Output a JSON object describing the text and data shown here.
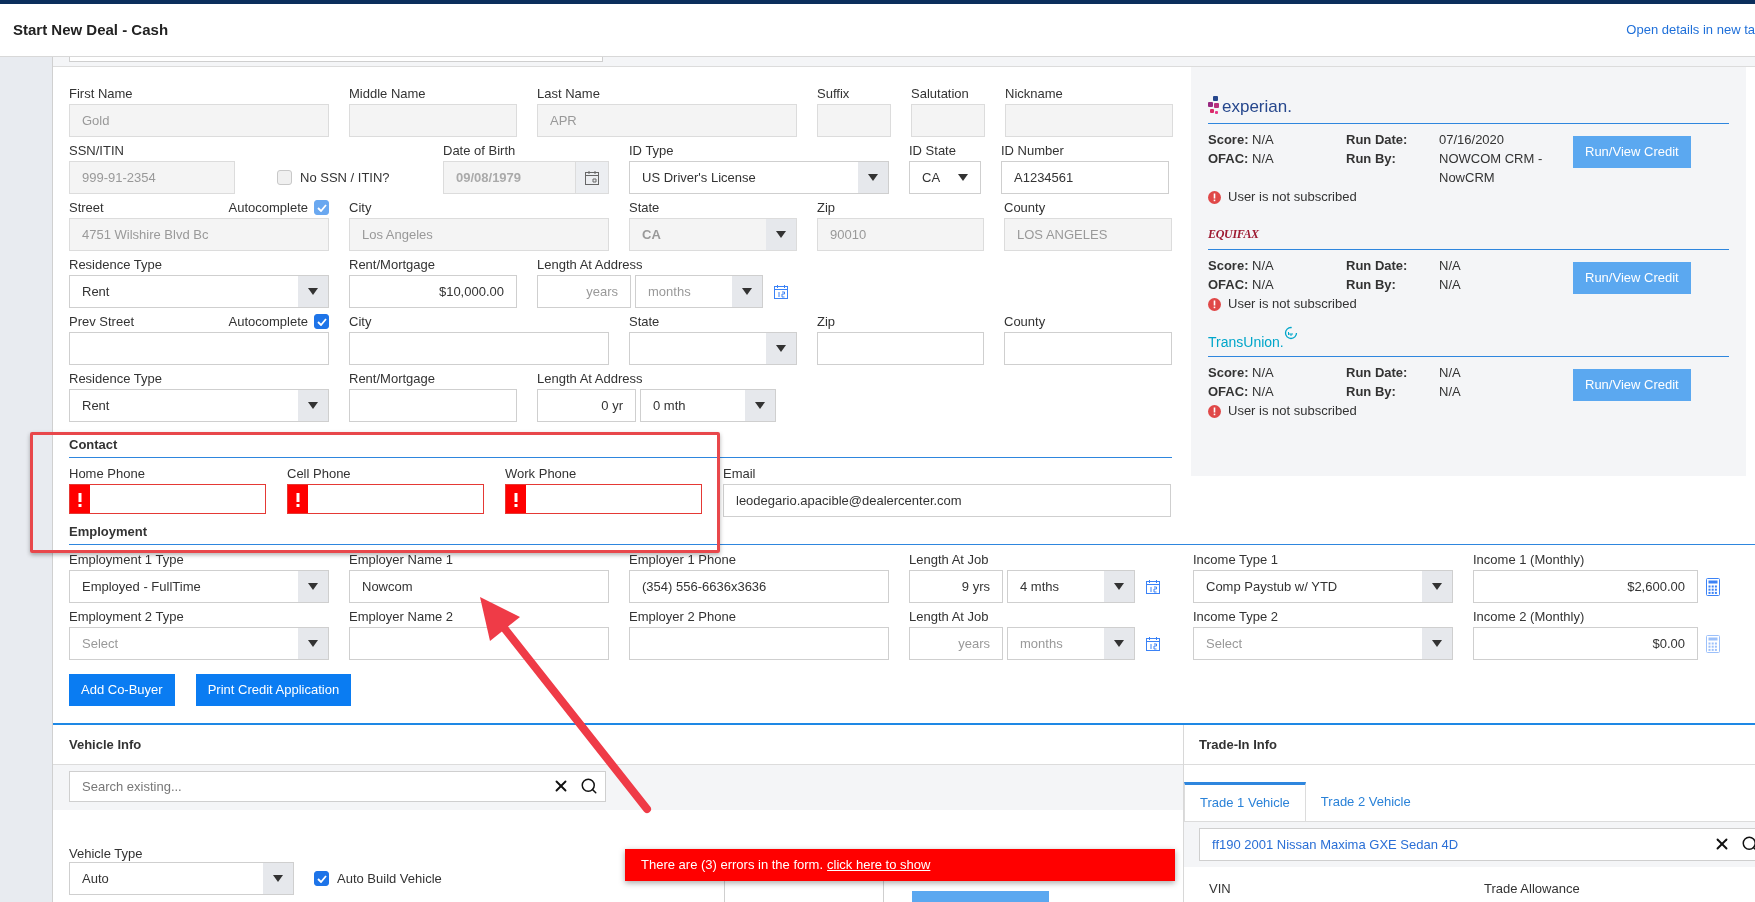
{
  "header": {
    "title": "Start New Deal - Cash",
    "link": "Open details in new ta"
  },
  "form_rows": [
    {
      "fields": [
        {
          "label": "First Name",
          "kind": "readonly",
          "value": "Gold"
        },
        {
          "label": "Middle Name",
          "kind": "readonly"
        },
        {
          "label": "Last Name",
          "kind": "readonly",
          "value": "APR"
        },
        {
          "label": "Suffix",
          "kind": "readonly"
        },
        {
          "label": "Salutation",
          "kind": "readonly"
        },
        {
          "label": "Nickname",
          "kind": "readonly"
        }
      ]
    },
    {
      "fields": [
        {
          "label": "SSN/ITIN",
          "kind": "readonly",
          "value": "999-91-2354"
        },
        {
          "kind": "checkbox",
          "label": "No SSN / ITIN?",
          "checked": false
        },
        {
          "label": "Date of Birth",
          "kind": "date_readonly",
          "value": "09/08/1979"
        },
        {
          "label": "ID Type",
          "kind": "select",
          "value": "US Driver's License"
        },
        {
          "label": "ID State",
          "kind": "select_small",
          "value": "CA"
        },
        {
          "label": "ID Number",
          "kind": "text",
          "value": "A1234561"
        }
      ]
    },
    {
      "fields": [
        {
          "label": "Street",
          "kind": "readonly",
          "value": "4751 Wilshire Blvd Bc",
          "autocomplete": {
            "label": "Autocomplete",
            "checked": true,
            "disabled": true
          }
        },
        {
          "label": "City",
          "kind": "readonly",
          "value": "Los Angeles"
        },
        {
          "label": "State",
          "kind": "select_readonly",
          "value": "CA"
        },
        {
          "label": "Zip",
          "kind": "readonly",
          "value": "90010"
        },
        {
          "label": "County",
          "kind": "readonly",
          "value": "LOS ANGELES"
        }
      ]
    },
    {
      "fields": [
        {
          "label": "Residence Type",
          "kind": "select",
          "value": "Rent"
        },
        {
          "label": "Rent/Mortgage",
          "kind": "number",
          "value": "$10,000.00"
        },
        {
          "label": "Length At Address",
          "kind": "compound",
          "calendar": true,
          "parts": [
            {
              "kind": "number",
              "placeholder": "years"
            },
            {
              "kind": "select",
              "placeholder": "months"
            }
          ]
        }
      ]
    },
    {
      "fields": [
        {
          "label": "Prev Street",
          "kind": "text",
          "autocomplete": {
            "label": "Autocomplete",
            "checked": true,
            "disabled": false
          }
        },
        {
          "label": "City",
          "kind": "text"
        },
        {
          "label": "State",
          "kind": "select"
        },
        {
          "label": "Zip",
          "kind": "text"
        },
        {
          "label": "County",
          "kind": "text"
        }
      ]
    },
    {
      "fields": [
        {
          "label": "Residence Type",
          "kind": "select",
          "value": "Rent"
        },
        {
          "label": "Rent/Mortgage",
          "kind": "text"
        },
        {
          "label": "Length At Address",
          "kind": "compound",
          "calendar": false,
          "parts": [
            {
              "kind": "number",
              "value": "0 yr"
            },
            {
              "kind": "select",
              "value": "0 mth"
            }
          ]
        }
      ]
    }
  ],
  "contact": {
    "heading": "Contact",
    "fields": [
      {
        "label": "Home Phone",
        "kind": "error"
      },
      {
        "label": "Cell Phone",
        "kind": "error"
      },
      {
        "label": "Work Phone",
        "kind": "error"
      },
      {
        "label": "Email",
        "kind": "text",
        "value": "leodegario.apacible@dealercenter.com"
      }
    ]
  },
  "employment": {
    "heading": "Employment",
    "rows": [
      {
        "fields": [
          {
            "label": "Employment 1 Type",
            "kind": "select",
            "value": "Employed - FullTime"
          },
          {
            "label": "Employer Name 1",
            "kind": "text",
            "value": "Nowcom"
          },
          {
            "label": "Employer 1 Phone",
            "kind": "text",
            "value": "(354) 556-6636x3636"
          },
          {
            "label": "Length At Job",
            "kind": "compound",
            "calendar": true,
            "parts": [
              {
                "kind": "number",
                "value": "9 yrs"
              },
              {
                "kind": "select",
                "value": "4 mths"
              }
            ]
          },
          {
            "label": "Income Type 1",
            "kind": "select",
            "value": "Comp Paystub w/ YTD"
          },
          {
            "label": "Income 1 (Monthly)",
            "kind": "number",
            "value": "$2,600.00",
            "calculator": true
          }
        ]
      },
      {
        "fields": [
          {
            "label": "Employment 2 Type",
            "kind": "select",
            "placeholder": "Select"
          },
          {
            "label": "Employer Name 2",
            "kind": "text"
          },
          {
            "label": "Employer 2 Phone",
            "kind": "text"
          },
          {
            "label": "Length At Job",
            "kind": "compound",
            "calendar": true,
            "parts": [
              {
                "kind": "number",
                "placeholder": "years"
              },
              {
                "kind": "select",
                "placeholder": "months"
              }
            ]
          },
          {
            "label": "Income Type 2",
            "kind": "select",
            "placeholder": "Select"
          },
          {
            "label": "Income 2 (Monthly)",
            "kind": "number",
            "value": "$0.00",
            "calculator": true
          }
        ]
      }
    ]
  },
  "buttons": [
    "Add Co-Buyer",
    "Print Credit Application"
  ],
  "credit_reports": [
    {
      "kind": "experian",
      "logo": "experian.",
      "score_label": "Score:",
      "score": "N/A",
      "ofac_label": "OFAC:",
      "ofac": "N/A",
      "run_date_label": "Run Date:",
      "run_date": "07/16/2020",
      "run_by_label": "Run By:",
      "run_by": "NOWCOM CRM - NowCRM",
      "warning": "User is not subscribed",
      "button": "Run/View Credit"
    },
    {
      "kind": "equifax",
      "logo": "EQUIFAX",
      "score_label": "Score:",
      "score": "N/A",
      "ofac_label": "OFAC:",
      "ofac": "N/A",
      "run_date_label": "Run Date:",
      "run_date": "N/A",
      "run_by_label": "Run By:",
      "run_by": "N/A",
      "warning": "User is not subscribed",
      "button": "Run/View Credit"
    },
    {
      "kind": "transunion",
      "logo": "TransUnion.",
      "score_label": "Score:",
      "score": "N/A",
      "ofac_label": "OFAC:",
      "ofac": "N/A",
      "run_date_label": "Run Date:",
      "run_date": "N/A",
      "run_by_label": "Run By:",
      "run_by": "N/A",
      "warning": "User is not subscribed",
      "button": "Run/View Credit"
    }
  ],
  "vehicle_info": {
    "title": "Vehicle Info",
    "search_placeholder": "Search existing...",
    "vehicle_type_label": "Vehicle Type",
    "vehicle_type": "Auto",
    "auto_build": {
      "label": "Auto Build Vehicle",
      "checked": true
    }
  },
  "trade_in": {
    "title": "Trade-In Info",
    "tabs": [
      {
        "label": "Trade 1 Vehicle",
        "selected": true
      },
      {
        "label": "Trade 2 Vehicle",
        "selected": false
      }
    ],
    "search_value": "ff190 2001 Nissan Maxima GXE Sedan 4D",
    "labels": [
      "VIN",
      "Trade Allowance"
    ]
  },
  "error_toast": {
    "text": "There are (3) errors in the form.",
    "link": "click here to show"
  }
}
